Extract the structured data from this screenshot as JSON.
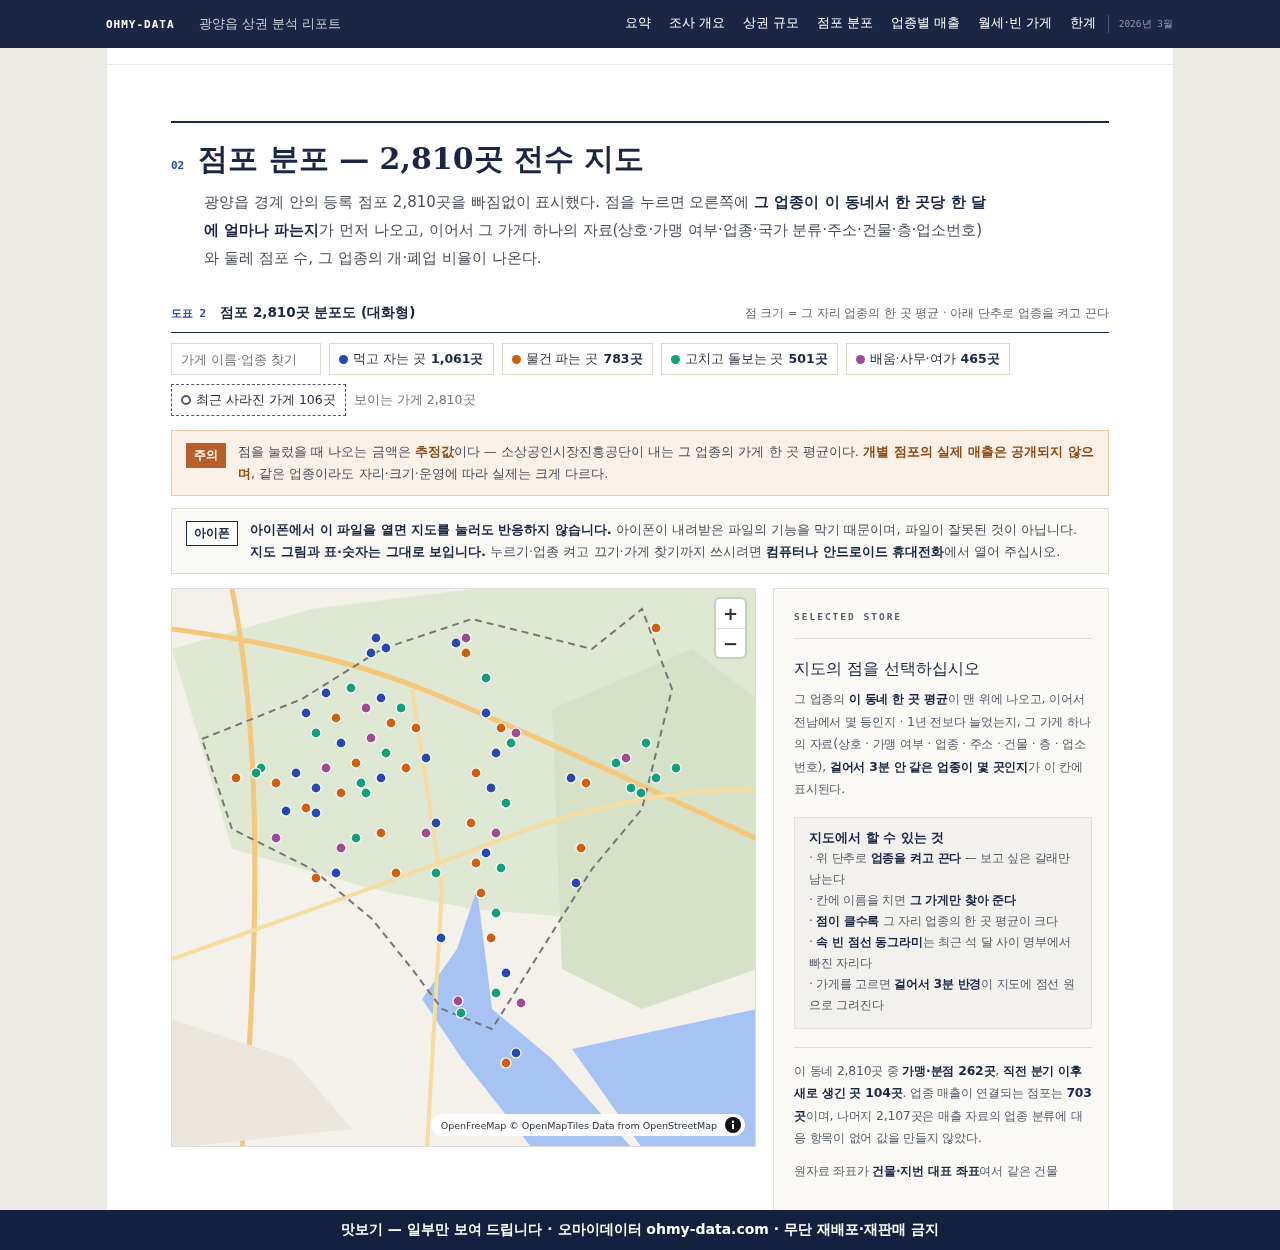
{
  "nav": {
    "brand": "OHMY-DATA",
    "title": "광양읍 상권 분석 리포트",
    "items": [
      {
        "label": "요약",
        "selected": false
      },
      {
        "label": "조사 개요",
        "selected": false
      },
      {
        "label": "상권 규모",
        "selected": false
      },
      {
        "label": "점포 분포",
        "selected": false
      },
      {
        "label": "업종별 매출",
        "selected": false
      },
      {
        "label": "월세·빈 가게",
        "selected": false
      },
      {
        "label": "한계",
        "selected": false
      }
    ],
    "date": "2026년 3월"
  },
  "section": {
    "number": "02",
    "title": "점포 분포 — 2,810곳 전수 지도",
    "lead": "광양읍 경계 안의 등록 점포 2,810곳을 빠짐없이 표시했다. 점을 누르면 오른쪽에 **그 업종이 이 동네서 한 곳당 한 달에 얼마나 파는지**가 먼저 나오고, 이어서 그 가게 하나의 자료(상호·가맹 여부·업종·국가 분류·주소·건물·층·업소번호)와 둘레 점포 수, 그 업종의 개·폐업 비율이 나온다."
  },
  "figure": {
    "label": "도표 2",
    "title": "점포 2,810곳 분포도 (대화형)",
    "note": "점 크기 = 그 자리 업종의 한 곳 평균 · 아래 단추로 업종을 켜고 끈다"
  },
  "filters": {
    "search": {
      "placeholder": "가게 이름·업종 찾기"
    },
    "categories": [
      {
        "label": "먹고 자는 곳",
        "count": "1,061곳",
        "color": "#2648b0",
        "on": true
      },
      {
        "label": "물건 파는 곳",
        "count": "783곳",
        "color": "#d0600f",
        "on": true
      },
      {
        "label": "고치고 돌보는 곳",
        "count": "501곳",
        "color": "#12a07a",
        "on": true
      },
      {
        "label": "배움·사무·여가",
        "count": "465곳",
        "color": "#a04a94",
        "on": true
      }
    ],
    "closed": {
      "label": "최근 사라진 가게",
      "count": "106곳",
      "on": true
    },
    "visible": "보이는 가게 2,810곳"
  },
  "notices": [
    {
      "kind": "warning",
      "badge": "주의",
      "text": "점을 눌렀을 때 나오는 금액은 **추정값**이다 — 소상공인시장진흥공단이 내는 그 업종의 가게 한 곳 평균이다. **개별 점포의 실제 매출은 공개되지 않으며**, 같은 업종이라도 자리·크기·운영에 따라 실제는 크게 다르다."
    },
    {
      "kind": "info",
      "badge": "아이폰",
      "text": "**아이폰에서 이 파일을 열면 지도를 눌러도 반응하지 않습니다.** 아이폰이 내려받은 파일의 기능을 막기 때문이며, 파일이 잘못된 것이 아닙니다. **지도 그림과 표·숫자는 그대로 보입니다.** 누르기·업종 켜고 끄기·가게 찾기까지 쓰시려면 **컴퓨터나 안드로이드 휴대전화**에서 열어 주십시오."
    }
  ],
  "map": {
    "kind": "picture",
    "zoom_in": "+",
    "zoom_out": "−",
    "attribution": "OpenFreeMap © OpenMapTiles Data from OpenStreetMap"
  },
  "panel": {
    "eyebrow": "SELECTED STORE",
    "title": "지도의 점을 선택하십시오",
    "intro": "그 업종의 **이 동네 한 곳 평균**이 맨 위에 나오고, 이어서 전남에서 몇 등인지 · 1년 전보다 늘었는지, 그 가게 하나의 자료(상호 · 가맹 여부 · 업종 · 주소 · 건물 · 층 · 업소번호), **걸어서 3분 안 같은 업종이 몇 곳인지**가 이 칸에 표시된다.",
    "tips": {
      "title": "지도에서 할 수 있는 것",
      "items": [
        "· 위 단추로 **업종을 켜고 끈다** — 보고 싶은 갈래만 남는다",
        "· 칸에 이름을 치면 **그 가게만 찾아 준다**",
        "· **점이 클수록** 그 자리 업종의 한 곳 평균이 크다",
        "· **속 빈 점선 동그라미**는 최근 석 달 사이 명부에서 빠진 자리다",
        "· 가게를 고르면 **걸어서 3분 반경**이 지도에 점선 원으로 그려진다"
      ]
    },
    "summary": "이 동네 2,810곳 중 **가맹·분점 262곳**, **직전 분기 이후 새로 생긴 곳 104곳**. 업종 매출이 연결되는 점포는 **703곳**이며, 나머지 2,107곳은 매출 자료의 업종 분류에 대응 항목이 없어 값을 만들지 않았다.",
    "footnote": "원자료 좌표가 **건물·지번 대표 좌표**여서 같은 건물"
  },
  "banner": "맛보기 — 일부만 보여 드립니다 · 오마이데이터 ohmy-data.com · 무단 재배포·재판매 금지"
}
